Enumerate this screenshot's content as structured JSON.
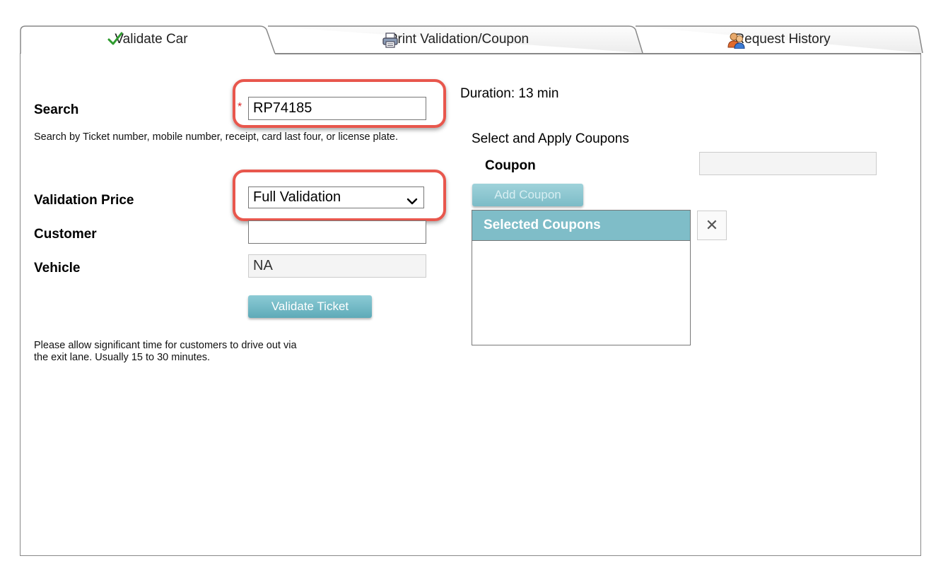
{
  "tabs": [
    {
      "label": "Validate Car",
      "icon": "checkmark-icon",
      "active": true
    },
    {
      "label": "Print Validation/Coupon",
      "icon": "printer-icon",
      "active": false
    },
    {
      "label": "Request History",
      "icon": "users-icon",
      "active": false
    }
  ],
  "search": {
    "label": "Search",
    "required_marker": "*",
    "value": "RP74185",
    "help": "Search by Ticket number, mobile number, receipt, card last four, or license plate."
  },
  "validation_price": {
    "label": "Validation Price",
    "selected": "Full Validation"
  },
  "customer": {
    "label": "Customer",
    "value": ""
  },
  "vehicle": {
    "label": "Vehicle",
    "value": "NA"
  },
  "validate_button": "Validate Ticket",
  "note_line1": "Please allow significant time for customers to drive out via",
  "note_line2": "the exit lane. Usually 15 to 30 minutes.",
  "duration": "Duration: 13 min",
  "coupons": {
    "section_title": "Select and Apply Coupons",
    "coupon_label": "Coupon",
    "coupon_value": "",
    "add_button": "Add Coupon",
    "selected_header": "Selected Coupons",
    "close_symbol": "✕"
  },
  "colors": {
    "accent": "#7fbdc8",
    "highlight": "#e8574d",
    "check": "#2e9b2e"
  }
}
